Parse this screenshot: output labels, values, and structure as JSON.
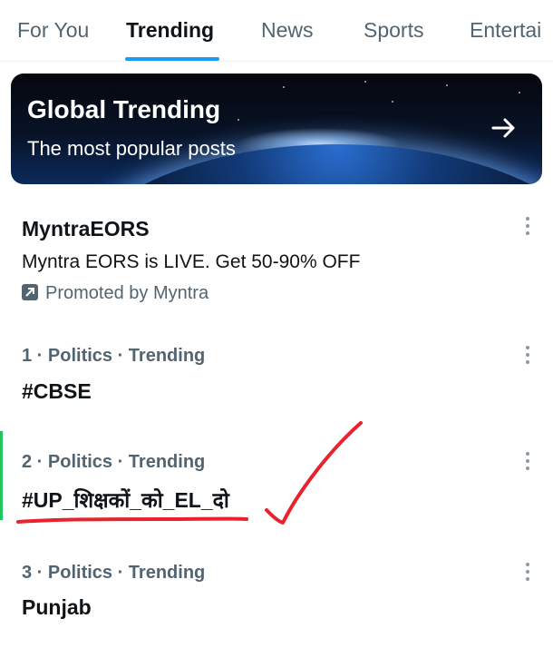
{
  "tabs": [
    {
      "label": "For You"
    },
    {
      "label": "Trending"
    },
    {
      "label": "News"
    },
    {
      "label": "Sports"
    },
    {
      "label": "Entertai"
    }
  ],
  "active_tab": "Trending",
  "banner": {
    "title": "Global Trending",
    "subtitle": "The most popular posts",
    "arrow_icon": "arrow-right-icon"
  },
  "promoted": {
    "title": "MyntraEORS",
    "description": "Myntra EORS is LIVE. Get 50-90% OFF",
    "promo_label": "Promoted by Myntra"
  },
  "trends": [
    {
      "meta": "1 · Politics · Trending",
      "title": "#CBSE"
    },
    {
      "meta": "2 · Politics · Trending",
      "title": "#UP_शिक्षकों_को_EL_दो"
    },
    {
      "meta": "3 · Politics · Trending",
      "title": "Punjab"
    }
  ],
  "colors": {
    "accent": "#1d9bf0",
    "annotation": "#e8232e",
    "secondary_text": "#536471"
  }
}
